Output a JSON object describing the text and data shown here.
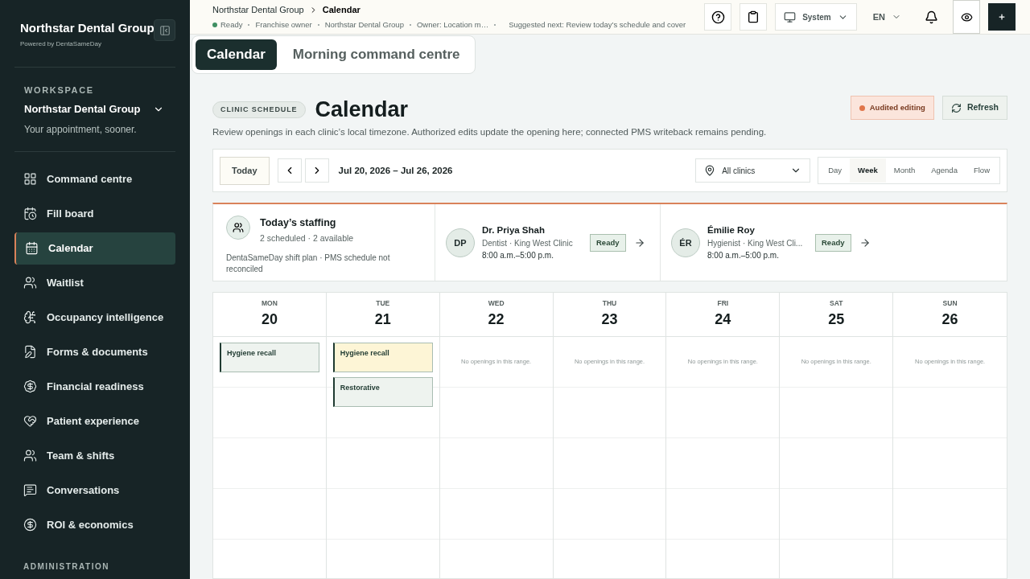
{
  "brand": {
    "title": "Northstar Dental Group",
    "subtitle": "Powered by DentaSameDay"
  },
  "workspace": {
    "label": "WORKSPACE",
    "name": "Northstar Dental Group",
    "tagline": "Your appointment, sooner."
  },
  "nav": [
    {
      "label": "Command centre",
      "selected": false
    },
    {
      "label": "Fill board",
      "selected": false
    },
    {
      "label": "Calendar",
      "selected": true
    },
    {
      "label": "Waitlist",
      "selected": false
    },
    {
      "label": "Occupancy intelligence",
      "selected": false
    },
    {
      "label": "Forms & documents",
      "selected": false
    },
    {
      "label": "Financial readiness",
      "selected": false
    },
    {
      "label": "Patient experience",
      "selected": false
    },
    {
      "label": "Team & shifts",
      "selected": false
    },
    {
      "label": "Conversations",
      "selected": false
    },
    {
      "label": "ROI & economics",
      "selected": false
    }
  ],
  "admin_label": "ADMINISTRATION",
  "breadcrumb": [
    "Northstar Dental Group",
    "Calendar"
  ],
  "status_line": [
    "Ready",
    "Franchise owner",
    "Northstar Dental Group",
    "Owner: Location m…",
    "Suggested next: Review today’s schedule and cover"
  ],
  "topbar": {
    "theme": "System",
    "language": "EN"
  },
  "page_tabs": [
    {
      "label": "Calendar",
      "selected": true
    },
    {
      "label": "Morning command centre",
      "selected": false
    }
  ],
  "header": {
    "badge": "CLINIC SCHEDULE",
    "title": "Calendar",
    "description": "Review openings in each clinic’s local timezone. Authorized edits update the opening here; connected PMS writeback remains pending.",
    "audit": "Audited editing",
    "refresh": "Refresh"
  },
  "toolbar": {
    "today": "Today",
    "range": "Jul 20, 2026 – Jul 26, 2026",
    "clinic": "All clinics",
    "views": [
      {
        "label": "Day",
        "selected": false
      },
      {
        "label": "Week",
        "selected": true
      },
      {
        "label": "Month",
        "selected": false
      },
      {
        "label": "Agenda",
        "selected": false
      },
      {
        "label": "Flow",
        "selected": false
      }
    ]
  },
  "staffing": {
    "title": "Today’s staffing",
    "summary": "2 scheduled · 2 available",
    "note": "DentaSameDay shift plan · PMS schedule not reconciled",
    "staff": [
      {
        "initials": "DP",
        "name": "Dr. Priya Shah",
        "role": "Dentist · King West Clinic",
        "hours": "8:00 a.m.–5:00 p.m.",
        "status": "Ready"
      },
      {
        "initials": "ÉR",
        "name": "Émilie Roy",
        "role": "Hygienist · King West Cli...",
        "hours": "8:00 a.m.–5:00 p.m.",
        "status": "Ready"
      }
    ]
  },
  "days": [
    {
      "weekday": "MON",
      "date": "20",
      "events": [
        {
          "title": "Hygiene recall",
          "color": "#eef3ef"
        }
      ]
    },
    {
      "weekday": "TUE",
      "date": "21",
      "events": [
        {
          "title": "Hygiene recall",
          "color": "#fdf5d6"
        },
        {
          "title": "Restorative",
          "color": "#eef3ef"
        }
      ]
    },
    {
      "weekday": "WED",
      "date": "22",
      "empty": "No openings in this range."
    },
    {
      "weekday": "THU",
      "date": "23",
      "empty": "No openings in this range."
    },
    {
      "weekday": "FRI",
      "date": "24",
      "empty": "No openings in this range."
    },
    {
      "weekday": "SAT",
      "date": "25",
      "empty": "No openings in this range."
    },
    {
      "weekday": "SUN",
      "date": "26",
      "empty": "No openings in this range."
    }
  ]
}
